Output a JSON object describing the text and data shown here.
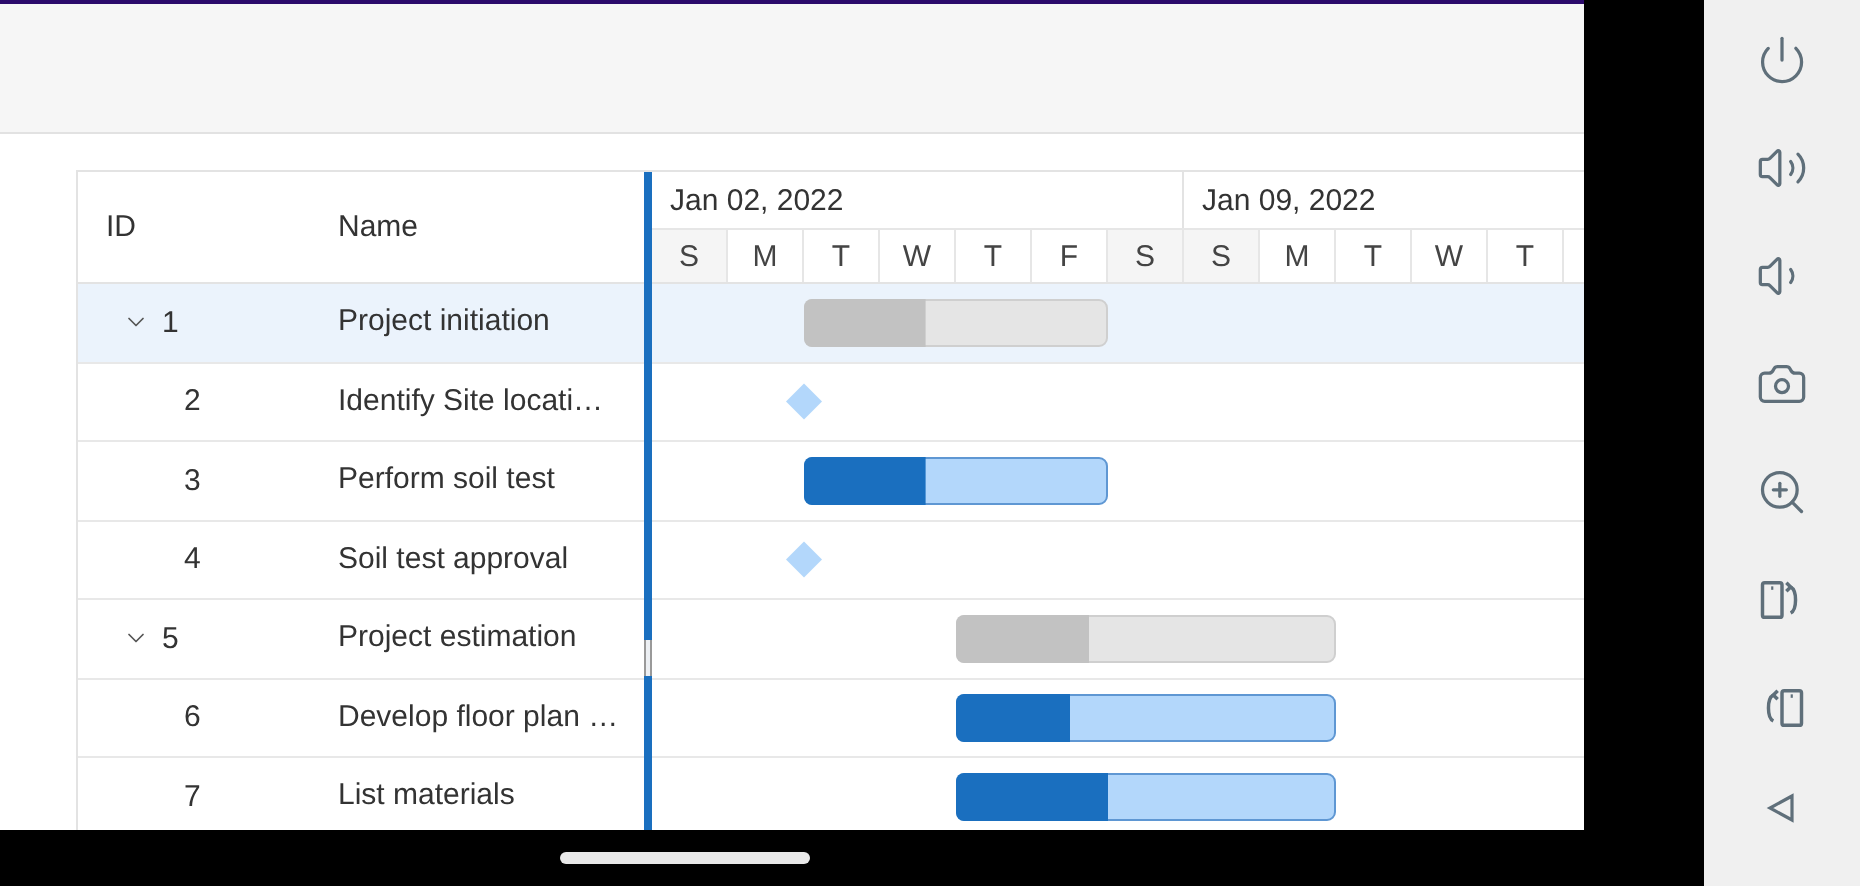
{
  "gantt": {
    "columns": [
      {
        "label": "ID"
      },
      {
        "label": "Name"
      }
    ],
    "timeline": {
      "weeks": [
        {
          "label": "Jan 02, 2022",
          "days": [
            "S",
            "M",
            "T",
            "W",
            "T",
            "F",
            "S"
          ]
        },
        {
          "label": "Jan 09, 2022",
          "days": [
            "S",
            "M",
            "T",
            "W",
            "T"
          ]
        }
      ]
    },
    "tasks": [
      {
        "id": "1",
        "name": "Project initiation",
        "kind": "summary",
        "expanded": true,
        "selected": true,
        "level": 0.4,
        "children": [
          {
            "id": "2",
            "name": "Identify Site locati…",
            "kind": "milestone",
            "selected": false
          },
          {
            "id": "3",
            "name": "Perform soil test",
            "kind": "task",
            "selected": false,
            "level": 0.4
          },
          {
            "id": "4",
            "name": "Soil test approval",
            "kind": "milestone",
            "selected": false
          }
        ]
      },
      {
        "id": "5",
        "name": "Project estimation",
        "kind": "summary",
        "expanded": true,
        "selected": false,
        "level": 0.35,
        "children": [
          {
            "id": "6",
            "name": "Develop floor plan …",
            "kind": "task",
            "selected": false,
            "level": 0.3
          },
          {
            "id": "7",
            "name": "List materials",
            "kind": "task",
            "selected": false,
            "level": 0.4
          }
        ]
      }
    ]
  }
}
